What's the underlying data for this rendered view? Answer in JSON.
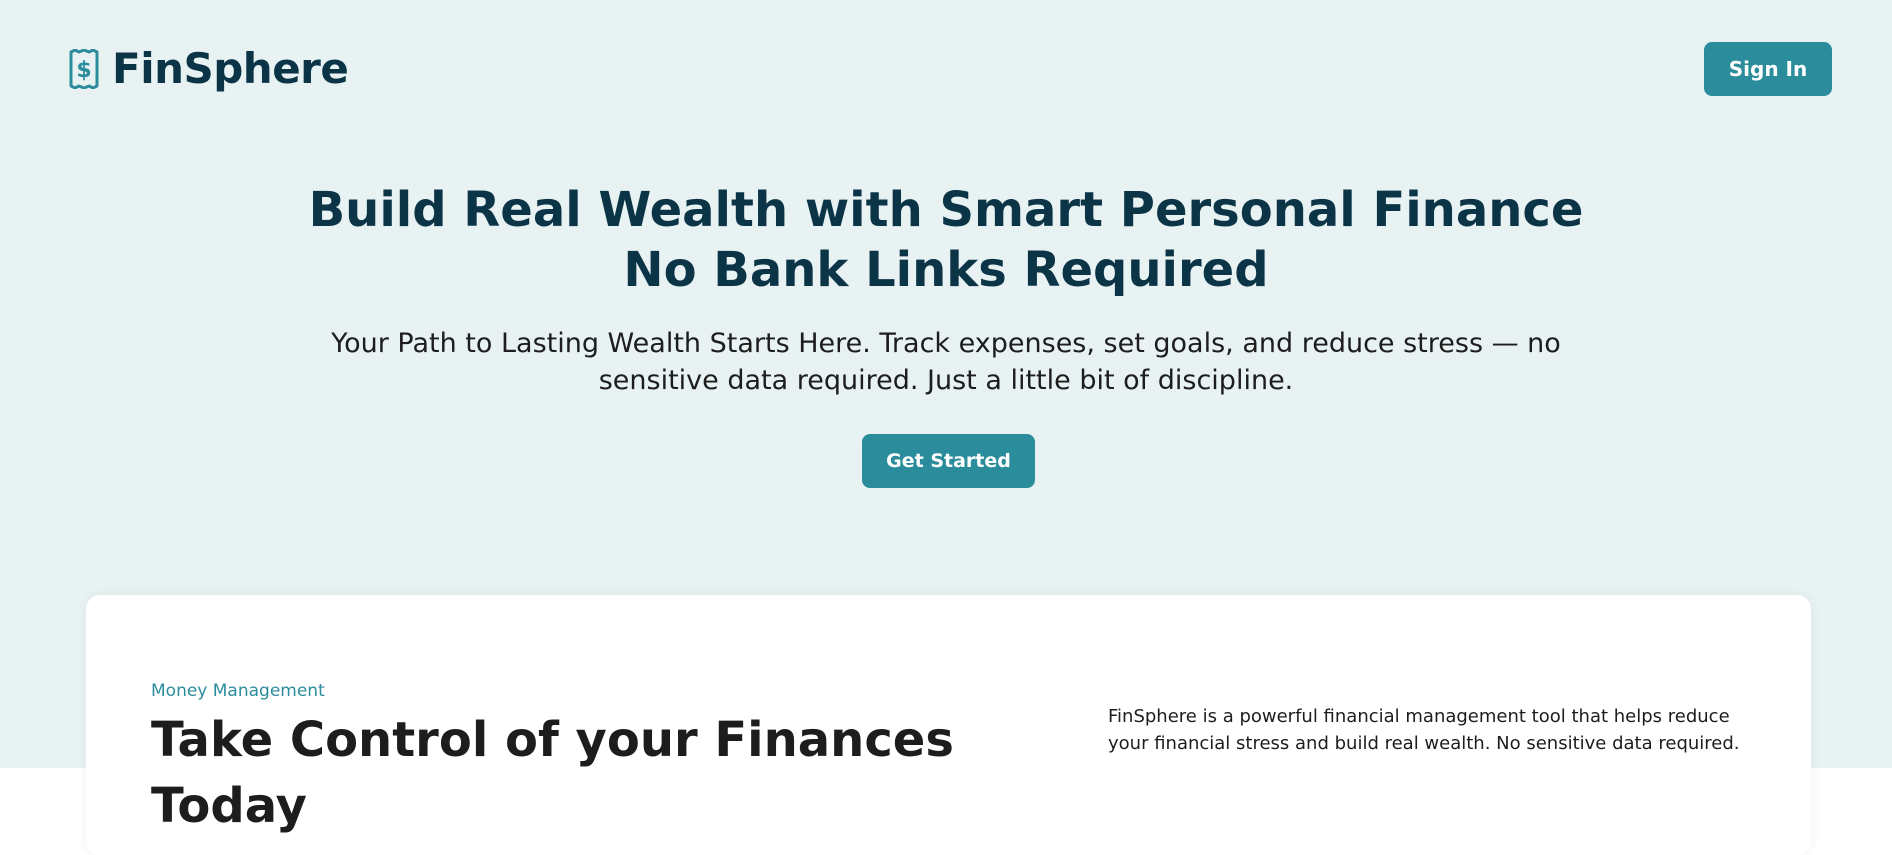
{
  "brand": {
    "name": "FinSphere",
    "icon": "receipt-dollar-icon",
    "color": "#0b3447",
    "icon_color": "#2b8d9c"
  },
  "header": {
    "signin_label": "Sign In"
  },
  "hero": {
    "headline_line1": "Build Real Wealth with Smart Personal Finance",
    "headline_line2": "No Bank Links Required",
    "subtitle": "Your Path to Lasting Wealth Starts Here. Track expenses, set goals, and reduce stress — no sensitive data required. Just a little bit of discipline.",
    "cta_label": "Get Started",
    "background": "#e8f2f3"
  },
  "feature": {
    "eyebrow": "Money Management",
    "title": "Take Control of your Finances Today",
    "description": "FinSphere is a powerful financial management tool that helps reduce your financial stress and build real wealth. No sensitive data required."
  },
  "colors": {
    "accent": "#2b8d9c",
    "heading": "#0b3447",
    "text": "#1d1d1d"
  }
}
